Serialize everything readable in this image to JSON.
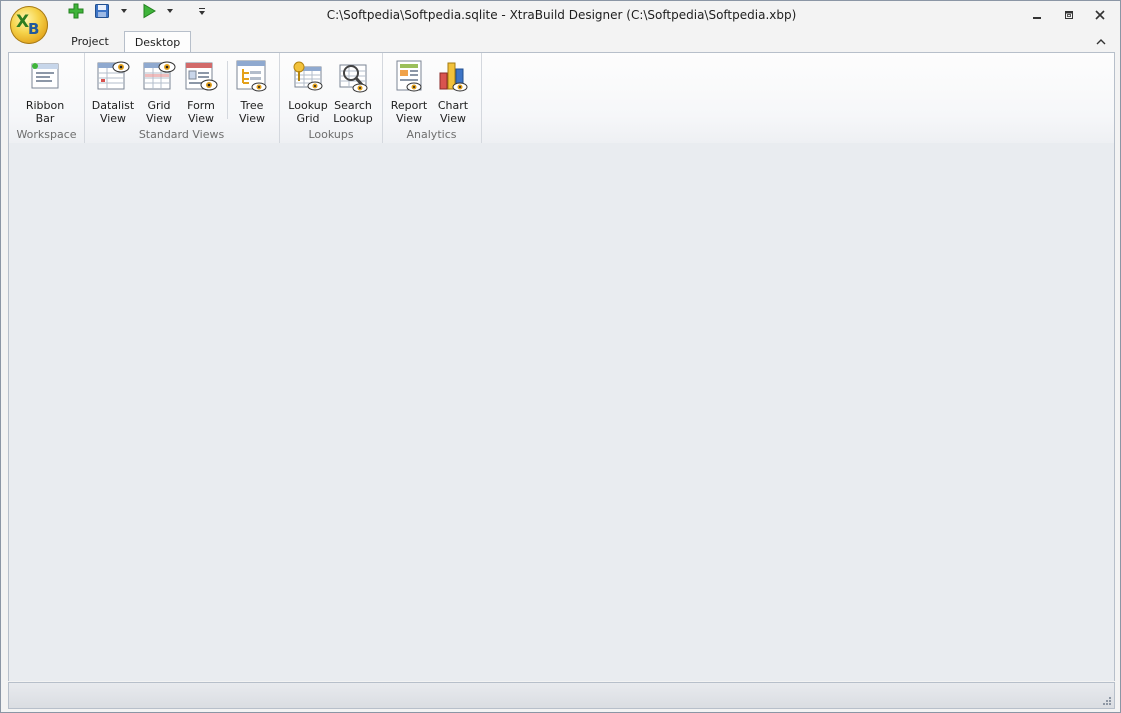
{
  "window": {
    "title": "C:\\Softpedia\\Softpedia.sqlite - XtraBuild Designer (C:\\Softpedia\\Softpedia.xbp)"
  },
  "logo": {
    "letter1": "X",
    "letter2": "B"
  },
  "qat": {
    "icons": [
      "add-icon",
      "save-icon",
      "run-icon",
      "customize-icon"
    ]
  },
  "tabs": [
    {
      "label": "Project",
      "active": false
    },
    {
      "label": "Desktop",
      "active": true
    }
  ],
  "ribbon": {
    "groups": [
      {
        "caption": "Workspace",
        "buttons": [
          {
            "line1": "Ribbon",
            "line2": "Bar",
            "icon": "ribbon-bar-icon"
          }
        ]
      },
      {
        "caption": "Standard Views",
        "buttons": [
          {
            "line1": "Datalist",
            "line2": "View",
            "icon": "datalist-view-icon"
          },
          {
            "line1": "Grid",
            "line2": "View",
            "icon": "grid-view-icon"
          },
          {
            "line1": "Form",
            "line2": "View",
            "icon": "form-view-icon"
          },
          {
            "line1": "Tree",
            "line2": "View",
            "icon": "tree-view-icon"
          }
        ]
      },
      {
        "caption": "Lookups",
        "buttons": [
          {
            "line1": "Lookup",
            "line2": "Grid",
            "icon": "lookup-grid-icon"
          },
          {
            "line1": "Search",
            "line2": "Lookup",
            "icon": "search-lookup-icon"
          }
        ]
      },
      {
        "caption": "Analytics",
        "buttons": [
          {
            "line1": "Report",
            "line2": "View",
            "icon": "report-view-icon"
          },
          {
            "line1": "Chart",
            "line2": "View",
            "icon": "chart-view-icon"
          }
        ]
      }
    ]
  },
  "colors": {
    "accent": "#2b6fc2",
    "ribbon_bg": "#fdfdfd",
    "content_bg": "#e9ecf0"
  }
}
